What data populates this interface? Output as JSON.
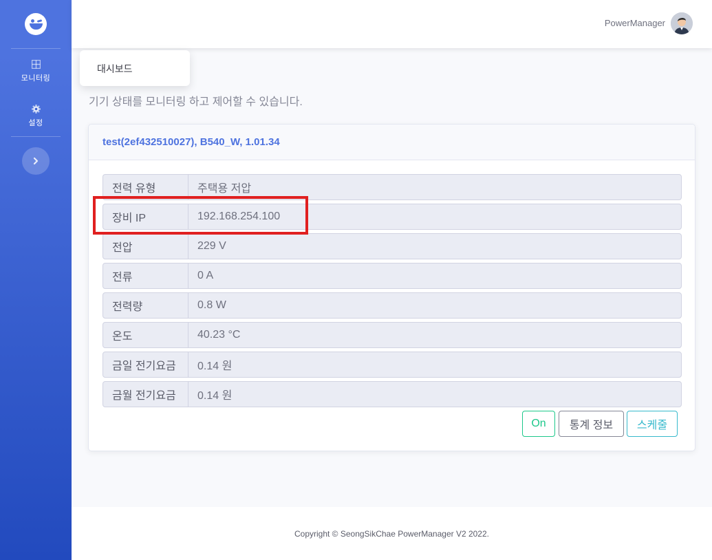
{
  "sidebar": {
    "brand_icon": "laughing-face-logo",
    "items": [
      {
        "label": "모니터링",
        "icon": "grid-icon"
      },
      {
        "label": "설정",
        "icon": "gear-icon"
      }
    ],
    "toggle_icon": "chevron-right-icon"
  },
  "topbar": {
    "user_name": "PowerManager",
    "avatar_icon": "user-avatar"
  },
  "dropdown": {
    "items": [
      "대시보드"
    ]
  },
  "page": {
    "description": "기기 상태를 모니터링 하고 제어할 수 있습니다."
  },
  "device_card": {
    "title": "test(2ef432510027), B540_W, 1.01.34",
    "rows": [
      {
        "key": "전력 유형",
        "value": "주택용 저압"
      },
      {
        "key": "장비 IP",
        "value": "192.168.254.100"
      },
      {
        "key": "전압",
        "value": "229 V"
      },
      {
        "key": "전류",
        "value": "0 A"
      },
      {
        "key": "전력량",
        "value": "0.8 W"
      },
      {
        "key": "온도",
        "value": "40.23 °C"
      },
      {
        "key": "금일 전기요금",
        "value": "0.14 원"
      },
      {
        "key": "금월 전기요금",
        "value": "0.14 원"
      }
    ],
    "buttons": {
      "on": "On",
      "stats": "통계 정보",
      "schedule": "스케줄"
    }
  },
  "footer": {
    "text": "Copyright © SeongSikChae PowerManager V2 2022."
  },
  "colors": {
    "primary": "#4e73df",
    "success": "#1cc88a",
    "info": "#36b9cc",
    "highlight": "#e02020"
  }
}
